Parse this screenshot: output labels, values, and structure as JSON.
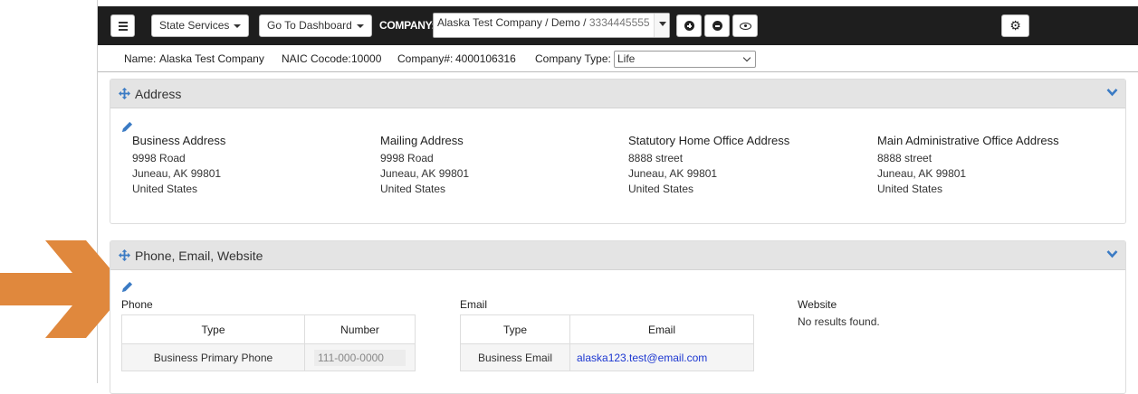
{
  "navbar": {
    "state_services_label": "State Services",
    "dashboard_label": "Go To Dashboard",
    "company_label": "COMPANY:",
    "company_name": "Alaska Test Company / Demo /",
    "company_number": "3334445555"
  },
  "info": {
    "name_label": "Name:",
    "name_value": "Alaska Test Company",
    "naic_label": "NAIC Cocode:",
    "naic_value": "10000",
    "company_num_label": "Company#:",
    "company_num_value": "4000106316",
    "type_label": "Company Type:",
    "type_value": "Life"
  },
  "address_panel": {
    "title": "Address",
    "columns": [
      {
        "heading": "Business Address",
        "line1": "9998 Road",
        "line2": "Juneau, AK 99801",
        "line3": "United States"
      },
      {
        "heading": "Mailing Address",
        "line1": "9998 Road",
        "line2": "Juneau, AK 99801",
        "line3": "United States"
      },
      {
        "heading": "Statutory Home Office Address",
        "line1": "8888 street",
        "line2": "Juneau, AK 99801",
        "line3": "United States"
      },
      {
        "heading": "Main Administrative Office Address",
        "line1": "8888 street",
        "line2": "Juneau, AK 99801",
        "line3": "United States"
      }
    ]
  },
  "contact_panel": {
    "title": "Phone, Email, Website",
    "phone": {
      "label": "Phone",
      "headers": [
        "Type",
        "Number"
      ],
      "rows": [
        {
          "type": "Business Primary Phone",
          "number": "111-000-0000"
        }
      ]
    },
    "email": {
      "label": "Email",
      "headers": [
        "Type",
        "Email"
      ],
      "rows": [
        {
          "type": "Business Email",
          "email": "alaska123.test@email.com"
        }
      ]
    },
    "website": {
      "label": "Website",
      "empty_text": "No results found."
    }
  },
  "colors": {
    "navbar_bg": "#1e1e1e",
    "panel_header_bg": "#e4e4e4",
    "accent_blue": "#3b7bc4",
    "link": "#1d38d1",
    "callout_arrow": "#e0883d"
  }
}
